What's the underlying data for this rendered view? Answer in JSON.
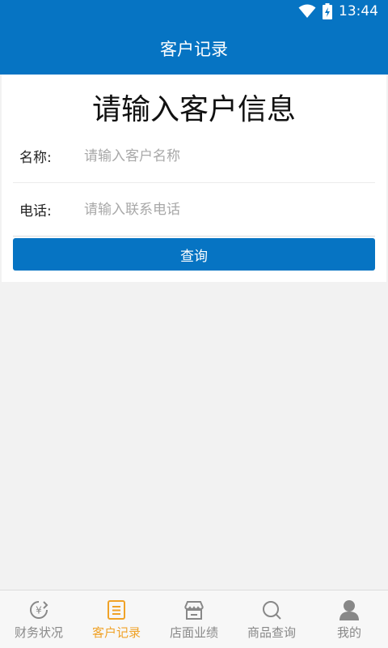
{
  "status_bar": {
    "time": "13:44"
  },
  "header": {
    "title": "客户记录"
  },
  "form": {
    "heading": "请输入客户信息",
    "name_label": "名称:",
    "name_placeholder": "请输入客户名称",
    "name_value": "",
    "phone_label": "电话:",
    "phone_placeholder": "请输入联系电话",
    "phone_value": "",
    "submit_label": "查询"
  },
  "tabs": [
    {
      "label": "财务状况",
      "icon": "finance-icon",
      "active": false
    },
    {
      "label": "客户记录",
      "icon": "customer-record-icon",
      "active": true
    },
    {
      "label": "店面业绩",
      "icon": "store-icon",
      "active": false
    },
    {
      "label": "商品查询",
      "icon": "search-icon",
      "active": false
    },
    {
      "label": "我的",
      "icon": "user-icon",
      "active": false
    }
  ],
  "colors": {
    "primary": "#0674c3",
    "active_tab": "#f0a227",
    "inactive_tab": "#888888"
  }
}
